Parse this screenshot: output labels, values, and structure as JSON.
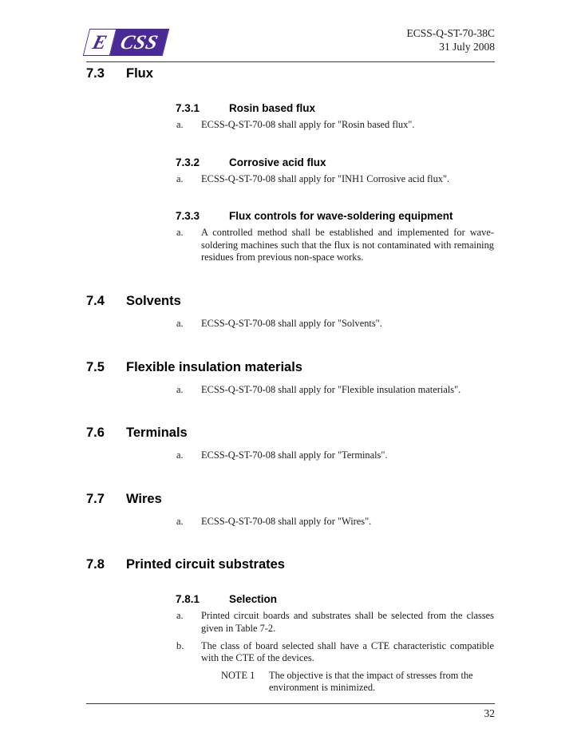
{
  "header": {
    "logo_first": "E",
    "logo_rest": "CSS",
    "logo_color": "#4a2a96",
    "document_id": "ECSS-Q-ST-70-38C",
    "document_date": "31 July 2008"
  },
  "footer": {
    "page_number": "32"
  },
  "sections": [
    {
      "number": "7.3",
      "title": "Flux",
      "subsections": [
        {
          "number": "7.3.1",
          "title": "Rosin based flux",
          "requirements": [
            {
              "marker": "a.",
              "text": "ECSS-Q-ST-70-08 shall apply for \"Rosin based flux\"."
            }
          ]
        },
        {
          "number": "7.3.2",
          "title": "Corrosive acid flux",
          "requirements": [
            {
              "marker": "a.",
              "text": "ECSS-Q-ST-70-08 shall apply for \"INH1 Corrosive acid flux\"."
            }
          ]
        },
        {
          "number": "7.3.3",
          "title": "Flux controls for wave-soldering equipment",
          "requirements": [
            {
              "marker": "a.",
              "text": "A controlled method shall be established and implemented for wave-soldering machines such that the flux is not contaminated with remaining residues from previous non-space works."
            }
          ]
        }
      ]
    },
    {
      "number": "7.4",
      "title": "Solvents",
      "requirements": [
        {
          "marker": "a.",
          "text": "ECSS-Q-ST-70-08 shall apply for \"Solvents\"."
        }
      ]
    },
    {
      "number": "7.5",
      "title": "Flexible insulation materials",
      "requirements": [
        {
          "marker": "a.",
          "text": "ECSS-Q-ST-70-08 shall apply for \"Flexible insulation materials\"."
        }
      ]
    },
    {
      "number": "7.6",
      "title": "Terminals",
      "requirements": [
        {
          "marker": "a.",
          "text": "ECSS-Q-ST-70-08 shall apply for \"Terminals\"."
        }
      ]
    },
    {
      "number": "7.7",
      "title": "Wires",
      "requirements": [
        {
          "marker": "a.",
          "text": "ECSS-Q-ST-70-08 shall apply for \"Wires\"."
        }
      ]
    },
    {
      "number": "7.8",
      "title": "Printed circuit substrates",
      "subsections": [
        {
          "number": "7.8.1",
          "title": "Selection",
          "requirements": [
            {
              "marker": "a.",
              "text": "Printed circuit boards and substrates shall be selected from the classes given in Table 7-2."
            },
            {
              "marker": "b.",
              "text": "The class of board selected shall have a CTE characteristic compatible with the CTE of the devices."
            }
          ],
          "notes": [
            {
              "label": "NOTE 1",
              "text": "The objective is that the impact of stresses from the environment is minimized."
            }
          ]
        }
      ]
    }
  ]
}
